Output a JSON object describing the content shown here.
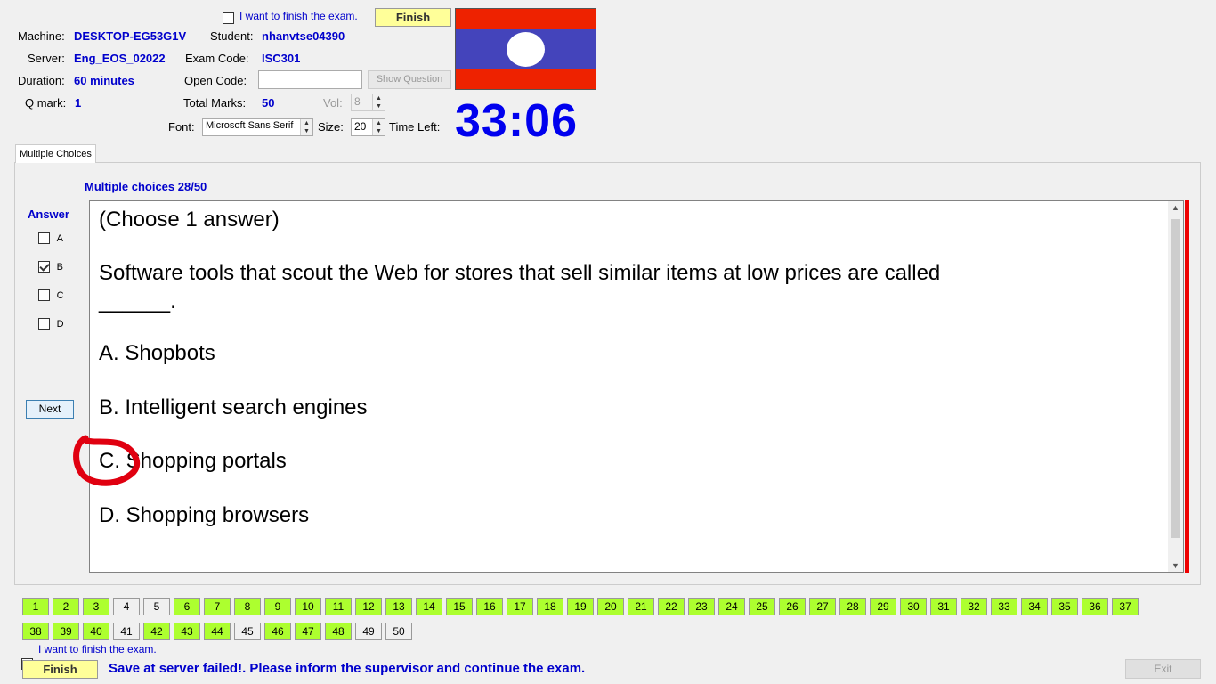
{
  "header": {
    "finish_check_label": "I want to finish the exam.",
    "finish_button": "Finish",
    "machine_label": "Machine:",
    "machine_value": "DESKTOP-EG53G1V",
    "student_label": "Student:",
    "student_value": "nhanvtse04390",
    "server_label": "Server:",
    "server_value": "Eng_EOS_02022",
    "exam_code_label": "Exam Code:",
    "exam_code_value": "ISC301",
    "duration_label": "Duration:",
    "duration_value": "60 minutes",
    "open_code_label": "Open Code:",
    "open_code_value": "",
    "show_question_button": "Show Question",
    "qmark_label": "Q mark:",
    "qmark_value": "1",
    "total_marks_label": "Total Marks:",
    "total_marks_value": "50",
    "vol_label": "Vol:",
    "vol_value": "8",
    "font_label": "Font:",
    "font_value": "Microsoft Sans Serif",
    "size_label": "Size:",
    "size_value": "20",
    "time_left_label": "Time Left:",
    "timer": "33:06"
  },
  "flag": {
    "top": "#ee2200",
    "middle": "#4444bb",
    "bottom": "#ee2200",
    "disc": "#ffffff"
  },
  "tab": {
    "label": "Multiple Choices"
  },
  "question": {
    "counter": "Multiple choices 28/50",
    "answer_heading": "Answer",
    "options": [
      {
        "letter": "A",
        "checked": false
      },
      {
        "letter": "B",
        "checked": true
      },
      {
        "letter": "C",
        "checked": false
      },
      {
        "letter": "D",
        "checked": false
      }
    ],
    "next_button": "Next",
    "instruction": "(Choose 1 answer)",
    "stem_line1": "Software tools that scout the Web for stores that sell similar items at low prices are called",
    "stem_line2": "______.",
    "choice_a": "A.  Shopbots",
    "choice_b": "B.  Intelligent search engines",
    "choice_c": "C.  Shopping portals",
    "choice_d": "D.  Shopping browsers"
  },
  "navigator": {
    "row1": [
      "1",
      "2",
      "3",
      "4",
      "5",
      "6",
      "7",
      "8",
      "9",
      "10",
      "11",
      "12",
      "13",
      "14",
      "15",
      "16",
      "17",
      "18",
      "19",
      "20",
      "21",
      "22",
      "23",
      "24",
      "25",
      "26",
      "27",
      "28",
      "29",
      "30",
      "31",
      "32",
      "33",
      "34",
      "35",
      "36",
      "37"
    ],
    "row1_answered": [
      true,
      true,
      true,
      false,
      false,
      true,
      true,
      true,
      true,
      true,
      true,
      true,
      true,
      true,
      true,
      true,
      true,
      true,
      true,
      true,
      true,
      true,
      true,
      true,
      true,
      true,
      true,
      true,
      true,
      true,
      true,
      true,
      true,
      true,
      true,
      true,
      true
    ],
    "row2": [
      "38",
      "39",
      "40",
      "41",
      "42",
      "43",
      "44",
      "45",
      "46",
      "47",
      "48",
      "49",
      "50"
    ],
    "row2_answered": [
      true,
      true,
      true,
      false,
      true,
      true,
      true,
      false,
      true,
      true,
      true,
      false,
      false
    ]
  },
  "footer": {
    "finish_check_label": "I want to finish the exam.",
    "finish_button": "Finish",
    "status_message": "Save at server failed!. Please inform the supervisor and continue the exam.",
    "exit_button": "Exit"
  }
}
